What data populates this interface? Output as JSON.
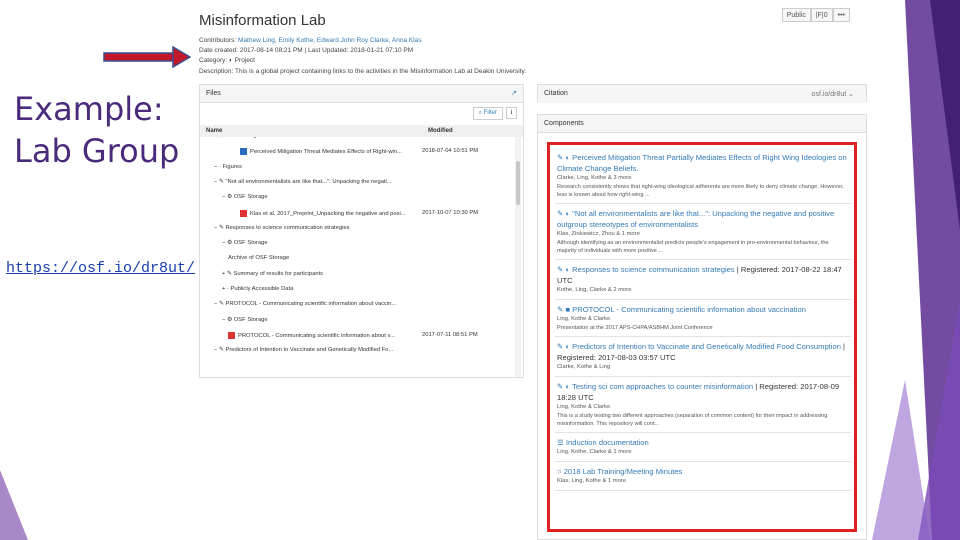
{
  "slide": {
    "title_line1": "Example:",
    "title_line2": "Lab Group",
    "link": "https://osf.io/dr8ut/",
    "colors": {
      "title": "#4a2a7a",
      "link": "#1a3fb0",
      "highlight": "#e02020",
      "arrow": "#c0182a",
      "deco": "#6a3aa0"
    }
  },
  "project": {
    "title": "Misinformation Lab",
    "buttons": [
      "Public",
      "|F|0",
      "•••"
    ],
    "contributors_label": "Contributors:",
    "contributors": "Mathew Ling, Emily Kothe, Edward John Roy Clarke, Anna Klas",
    "dates": "Date created: 2017-08-14 08:21 PM | Last Updated: 2018-01-21 07:10 PM",
    "category": "Category: ◐ Project",
    "description": "Description: This is a global project containing links to the activities in the Misinformation Lab at Deakin University."
  },
  "files": {
    "title": "Files",
    "filter_label": "⌕ Filter",
    "info_label": "i",
    "col_name": "Name",
    "col_modified": "Modified",
    "rows": [
      {
        "text": "−  ⚙  OSF Storage",
        "date": ""
      },
      {
        "text": "Perceived Mitigation Threat Mediates Effects of Right-win...",
        "date": "2018-07-04 10:51 PM"
      },
      {
        "text": "−  ·  Figures",
        "date": ""
      },
      {
        "text": "−  ✎  \"Not all environmentalists are like that...\": Unpacking the negati...",
        "date": ""
      },
      {
        "text": "−  ⚙  OSF Storage",
        "date": ""
      },
      {
        "text": "Klas et al. 2017_Preprint_Unpacking the negative and posi...",
        "date": "2017-10-07 10:30 PM"
      },
      {
        "text": "−  ✎  Responses to science communication strategies",
        "date": ""
      },
      {
        "text": "−  ⚙  OSF Storage",
        "date": ""
      },
      {
        "text": "Archive of OSF Storage",
        "date": ""
      },
      {
        "text": "+  ✎  Summary of results for participants",
        "date": ""
      },
      {
        "text": "+  ·  Publicly Accessible Data",
        "date": ""
      },
      {
        "text": "−  ✎  PROTOCOL - Communicating scientific information about vaccin...",
        "date": ""
      },
      {
        "text": "−  ⚙  OSF Storage",
        "date": ""
      },
      {
        "text": "PROTOCOL - Communicating scientific information about v...",
        "date": "2017-07-11 08:51 PM"
      },
      {
        "text": "−  ✎  Predictors of Intention to Vaccinate and Genetically Modified Fo...",
        "date": ""
      }
    ]
  },
  "citation": {
    "title": "Citation",
    "right": "osf.io/dr8ut ⌄"
  },
  "components": {
    "title": "Components",
    "items": [
      {
        "title": "✎ ◐ Perceived Mitigation Threat Partially Mediates Effects of Right Wing Ideologies on Climate Change Beliefs.",
        "registered": "",
        "contributors": "Clarke, Ling, Kothe & 3 more",
        "description": "Research consistently shows that right-wing ideological adherents are more likely to deny climate change. However, less is known about how right-wing ..."
      },
      {
        "title": "✎ ◐ \"Not all environmentalists are like that...\": Unpacking the negative and positive outgroup stereotypes of environmentalists",
        "registered": "",
        "contributors": "Klas, Zinkiewicz, Zhou & 1 more",
        "description": "Although identifying as an environmentalist predicts people's engagement in pro-environmental behaviour, the majority of individuals with more positive ..."
      },
      {
        "title": "✎ ◐ Responses to science communication strategies",
        "registered": " | Registered: 2017-08-22 18:47 UTC",
        "contributors": "Kothe, Ling, Clarke & 2 more",
        "description": ""
      },
      {
        "title": "✎ ■ PROTOCOL - Communicating scientific information about vaccination",
        "registered": "",
        "contributors": "Ling, Kothe & Clarke",
        "description": "Presentation at the 2017 APS-CHPA/ASBHM Joint Conference"
      },
      {
        "title": "✎ ◐ Predictors of Intention to Vaccinate and Genetically Modified Food Consumption",
        "registered": " | Registered: 2017-08-03 03:57 UTC",
        "contributors": "Clarke, Kothe & Ling",
        "description": ""
      },
      {
        "title": "✎ ◐ Testing sci com approaches to counter misinformation",
        "registered": " | Registered: 2017-08-09 18:28 UTC",
        "contributors": "Ling, Kothe & Clarke",
        "description": "This is a study testing two different approaches (separation of common content) for their impact in addressing misinformation. This repository will cont..."
      },
      {
        "title": "☰ Induction documentation",
        "registered": "",
        "contributors": "Ling, Kothe, Clarke & 1 more",
        "description": ""
      },
      {
        "title": "○ 2018 Lab Training/Meeting Minutes",
        "registered": "",
        "contributors": "Klas, Ling, Kothe & 1 more",
        "description": ""
      }
    ]
  }
}
